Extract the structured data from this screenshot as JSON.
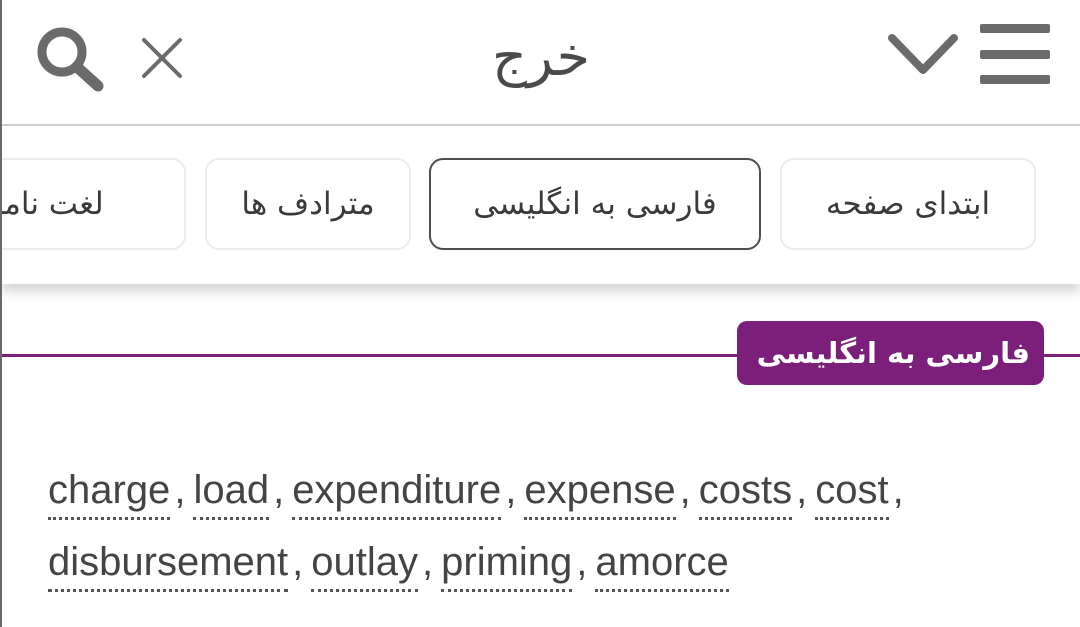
{
  "header": {
    "title": "خرج",
    "icons": [
      "search-icon",
      "close-icon",
      "chevron-down-icon",
      "menu-icon"
    ]
  },
  "tabs": [
    {
      "label": "ابتدای صفحه",
      "active": false
    },
    {
      "label": "فارسی به انگلیسی",
      "active": true
    },
    {
      "label": "مترادف ها",
      "active": false
    },
    {
      "label": "لغت نامه د",
      "active": false
    }
  ],
  "section": {
    "title": "فارسی به انگلیسی",
    "accent_color": "#7b1f7b"
  },
  "translations": {
    "words": [
      "charge",
      "load",
      "expenditure",
      "expense",
      "costs",
      "cost",
      "disbursement",
      "outlay",
      "priming",
      "amorce"
    ],
    "separator": ","
  }
}
